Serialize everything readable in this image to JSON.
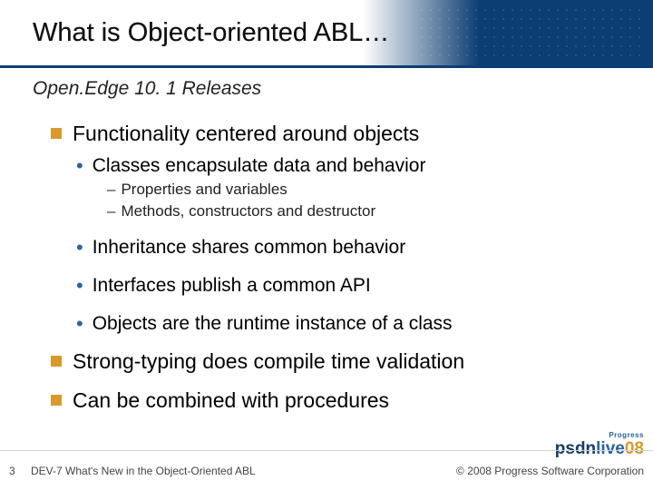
{
  "title": "What is Object-oriented ABL…",
  "subtitle": "Open.Edge 10. 1 Releases",
  "bullets": {
    "b1": "Functionality centered around objects",
    "b1_1": "Classes encapsulate data and behavior",
    "b1_1_1": "Properties and variables",
    "b1_1_2": "Methods, constructors and destructor",
    "b1_2": "Inheritance shares common behavior",
    "b1_3": "Interfaces publish a common API",
    "b1_4": "Objects are the runtime instance of a class",
    "b2": "Strong-typing does compile time validation",
    "b3": "Can be combined with procedures"
  },
  "footer": {
    "page": "3",
    "title": "DEV-7 What's New in the Object-Oriented ABL",
    "copyright": "© 2008 Progress Software Corporation"
  },
  "logo": {
    "top": "Progress",
    "brand_left": "psdn",
    "brand_mid": "live",
    "brand_right": "08"
  }
}
